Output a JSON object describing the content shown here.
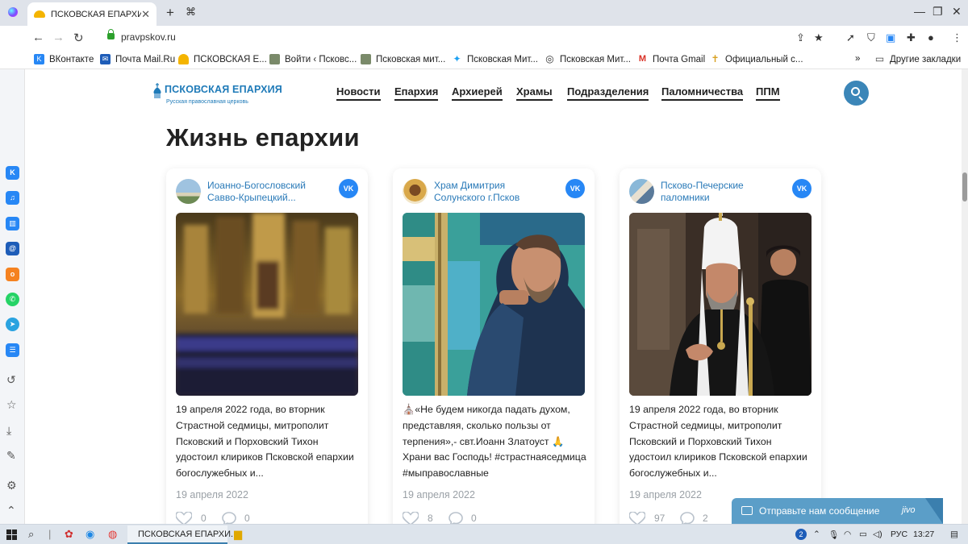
{
  "browser": {
    "tab_title": "ПСКОВСКАЯ ЕПАРХИЯ",
    "url": "pravpskov.ru",
    "bookmarks": [
      "ВКонтакте",
      "Почта Mail.Ru",
      "ПСКОВСКАЯ Е...",
      "Войти ‹ Псковс...",
      "Псковская мит...",
      "Псковская Мит...",
      "Псковская Мит...",
      "Почта Gmail",
      "Официальный с..."
    ],
    "bookmarks_more": "»",
    "other_bookmarks": "Другие закладки"
  },
  "site": {
    "logo_title": "ПСКОВСКАЯ ЕПАРХИЯ",
    "logo_subtitle": "Русская православная церковь",
    "nav": [
      "Новости",
      "Епархия",
      "Архиерей",
      "Храмы",
      "Подразделения",
      "Паломничества",
      "ППМ"
    ],
    "heading": "Жизнь епархии",
    "vk_badge": "VK",
    "cards": [
      {
        "source": "Иоанно-Богословский Савво-Крыпецкий...",
        "text": "19 апреля 2022 года, во вторник Страстной седмицы, митрополит Псковский и Порховский Тихон удостоил клириков Псковской епархии богослужебных и...",
        "date": "19 апреля 2022",
        "likes": "0",
        "comments": "0"
      },
      {
        "source": "Храм Димитрия Солунского г.Псков",
        "text": "⛪«Не будем никогда падать духом, представляя, сколько пользы от терпения»,- свт.Иоанн Златоуст 🙏 Храни вас Господь! #страстнаяседмица #мыправославные",
        "date": "19 апреля 2022",
        "likes": "8",
        "comments": "0"
      },
      {
        "source": "Псково-Печерские паломники",
        "text": "19 апреля 2022 года, во вторник Страстной седмицы, митрополит Псковский и Порховский Тихон удостоил клириков Псковской епархии богослужебных и...",
        "date": "19 апреля 2022",
        "likes": "97",
        "comments": "2"
      }
    ],
    "chat_label": "Отправьте нам сообщение",
    "chat_brand": "jivo"
  },
  "taskbar": {
    "task_title": "ПСКОВСКАЯ ЕПАРХИ...",
    "notif_count": "2",
    "lang": "РУС",
    "time": "13:27"
  },
  "colors": {
    "accent": "#3b86b8",
    "link": "#2a7ab8",
    "vk": "#2787f5",
    "chat": "#5b9ec8"
  }
}
